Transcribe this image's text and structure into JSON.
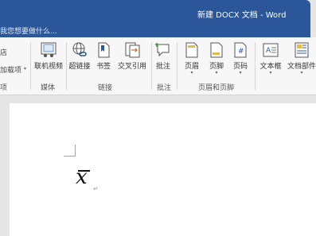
{
  "window": {
    "title": "新建 DOCX 文档 - Word"
  },
  "tellme": {
    "text": "我您想要做什么..."
  },
  "ribbon": {
    "left_top_fragment": "店",
    "left_mid_fragment": "加载项",
    "left_group_fragment": "项",
    "items": {
      "online_video": "联机视频",
      "hyperlink": "超链接",
      "bookmark": "书签",
      "cross_ref": "交叉引用",
      "comment": "批注",
      "header": "页眉",
      "footer": "页脚",
      "page_number": "页码",
      "textbox": "文本框",
      "docparts": "文档部件"
    },
    "groups": {
      "media": "媒体",
      "links": "链接",
      "comments": "批注",
      "header_footer": "页眉和页脚"
    }
  },
  "document": {
    "equation": "x",
    "paragraph_mark": "↵"
  }
}
